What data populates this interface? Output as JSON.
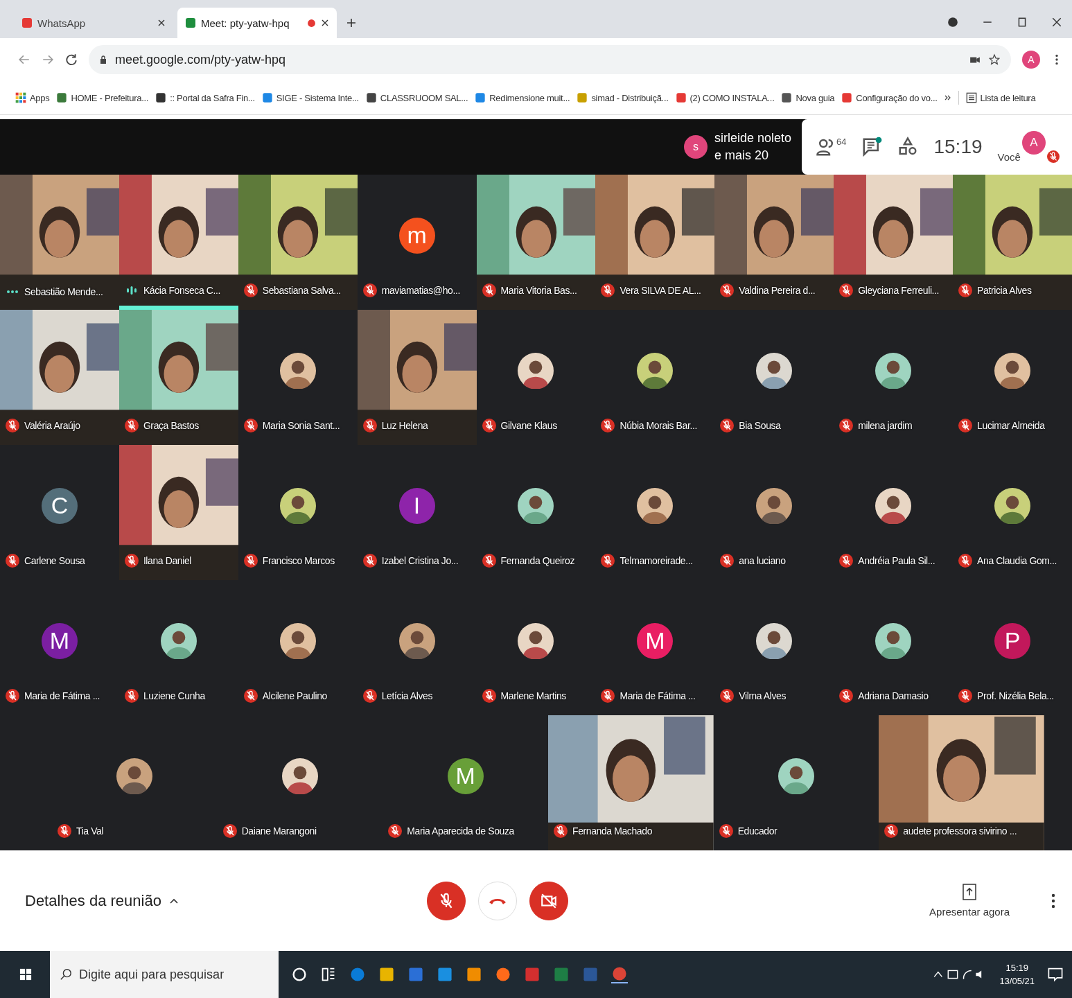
{
  "browser": {
    "tabs": [
      {
        "title": "WhatsApp",
        "selected": false,
        "recording": false
      },
      {
        "title": "Meet: pty-yatw-hpq",
        "selected": true,
        "recording": true
      }
    ],
    "url": "meet.google.com/pty-yatw-hpq",
    "profile": "A",
    "bookmarks": [
      "Apps",
      "HOME - Prefeitura...",
      ":: Portal da Safra Fin...",
      "SIGE - Sistema Inte...",
      "CLASSRUOOM SAL...",
      "Redimensione muit...",
      "simad - Distribuiçã...",
      "(2) COMO INSTALA...",
      "Nova guia",
      "Configuração do vo..."
    ],
    "reading_list": "Lista de leitura"
  },
  "meeting": {
    "presenter": {
      "initial": "s",
      "name": "sirleide noleto",
      "more": "e mais 20"
    },
    "participant_count": "64",
    "time": "15:19",
    "self": {
      "initial": "A",
      "label": "Você",
      "muted": true
    },
    "participants": [
      {
        "name": "Sebastião Mende...",
        "kind": "video",
        "muted": false,
        "speaking": false
      },
      {
        "name": "Kácia Fonseca C...",
        "kind": "video",
        "muted": false,
        "speaking": true
      },
      {
        "name": "Sebastiana Salva...",
        "kind": "video",
        "muted": true,
        "speaking": false
      },
      {
        "name": "maviamatias@ho...",
        "kind": "letter",
        "letter": "m",
        "color": "#f4511e",
        "muted": true,
        "speaking": false
      },
      {
        "name": "Maria Vitoria Bas...",
        "kind": "video",
        "muted": true,
        "speaking": false
      },
      {
        "name": "Vera SILVA DE AL...",
        "kind": "video",
        "muted": true,
        "speaking": false
      },
      {
        "name": "Valdina Pereira d...",
        "kind": "video",
        "muted": true,
        "speaking": false
      },
      {
        "name": "Gleyciana Ferreuli...",
        "kind": "video",
        "muted": true,
        "speaking": false
      },
      {
        "name": "Patricia Alves",
        "kind": "video",
        "muted": true,
        "speaking": false
      },
      {
        "name": "Valéria Araújo",
        "kind": "video",
        "muted": true,
        "speaking": false
      },
      {
        "name": "Graça Bastos",
        "kind": "video",
        "muted": true,
        "speaking": false
      },
      {
        "name": "Maria Sonia Sant...",
        "muted": true,
        "speaking": false
      },
      {
        "name": "Luz Helena",
        "kind": "video",
        "muted": true,
        "speaking": false
      },
      {
        "name": "Gilvane Klaus",
        "muted": true,
        "speaking": false
      },
      {
        "name": "Núbia Morais Bar...",
        "muted": true,
        "speaking": false
      },
      {
        "name": "Bia Sousa",
        "muted": true,
        "speaking": false
      },
      {
        "name": "milena jardim",
        "muted": true,
        "speaking": false
      },
      {
        "name": "Lucimar Almeida",
        "muted": true,
        "speaking": false
      },
      {
        "name": "Carlene Sousa",
        "kind": "letter",
        "letter": "C",
        "color": "#546e7a",
        "muted": true,
        "speaking": false
      },
      {
        "name": "Ilana Daniel",
        "kind": "video",
        "muted": true,
        "speaking": false
      },
      {
        "name": "Francisco Marcos",
        "muted": true,
        "speaking": false
      },
      {
        "name": "Izabel Cristina Jo...",
        "kind": "letter",
        "letter": "I",
        "color": "#8e24aa",
        "muted": true,
        "speaking": false
      },
      {
        "name": "Fernanda Queiroz",
        "muted": true,
        "speaking": false
      },
      {
        "name": "Telmamoreirade...",
        "muted": true,
        "speaking": false
      },
      {
        "name": "ana luciano",
        "muted": true,
        "speaking": false
      },
      {
        "name": "Andréia Paula Sil...",
        "muted": true,
        "speaking": false
      },
      {
        "name": "Ana Claudia Gom...",
        "muted": true,
        "speaking": false
      },
      {
        "name": "Maria de Fátima ...",
        "kind": "letter",
        "letter": "M",
        "color": "#7b1fa2",
        "muted": true,
        "speaking": false
      },
      {
        "name": "Luziene Cunha",
        "muted": true,
        "speaking": false
      },
      {
        "name": "Alcilene Paulino",
        "muted": true,
        "speaking": false
      },
      {
        "name": "Letícia Alves",
        "muted": true,
        "speaking": false
      },
      {
        "name": "Marlene Martins",
        "muted": true,
        "speaking": false
      },
      {
        "name": "Maria de Fátima ...",
        "kind": "letter",
        "letter": "M",
        "color": "#e91e63",
        "muted": true,
        "speaking": false
      },
      {
        "name": "Vilma Alves",
        "muted": true,
        "speaking": false
      },
      {
        "name": "Adriana Damasio",
        "muted": true,
        "speaking": false
      },
      {
        "name": "Prof. Nizélia Bela...",
        "kind": "letter",
        "letter": "P",
        "color": "#c2185b",
        "muted": true,
        "speaking": false
      },
      {
        "name": "Tia Val",
        "muted": true,
        "speaking": false
      },
      {
        "name": "Daiane Marangoni",
        "muted": true,
        "speaking": false
      },
      {
        "name": "Maria Aparecida de Souza",
        "kind": "letter",
        "letter": "M",
        "color": "#689f38",
        "muted": true,
        "speaking": false
      },
      {
        "name": "Fernanda Machado",
        "kind": "video",
        "muted": true,
        "speaking": false
      },
      {
        "name": "Educador",
        "muted": true,
        "speaking": false
      },
      {
        "name": "audete professora sivirino ...",
        "kind": "video",
        "muted": true,
        "speaking": false
      }
    ],
    "details": "Detalhes da reunião",
    "mic_on": false,
    "camera_on": false,
    "present": "Apresentar agora"
  },
  "taskbar": {
    "search_placeholder": "Digite aqui para pesquisar",
    "time": "15:19",
    "date": "13/05/21"
  }
}
